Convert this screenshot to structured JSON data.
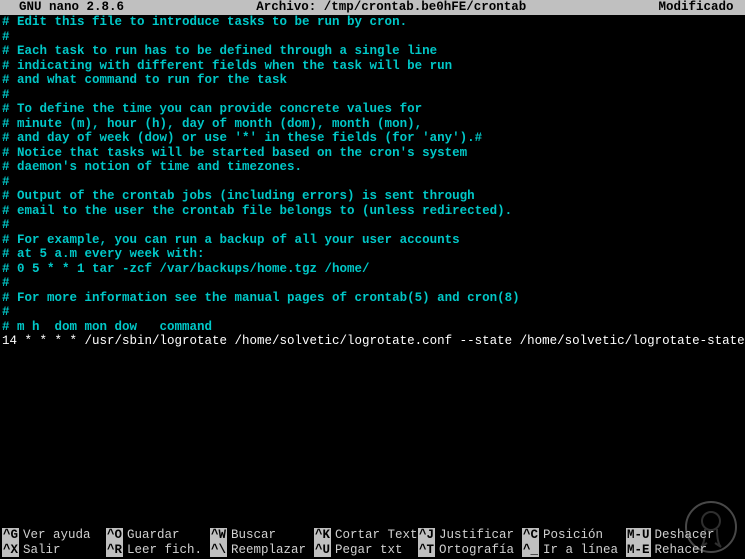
{
  "titlebar": {
    "left": "  GNU nano 2.8.6",
    "center": "Archivo: /tmp/crontab.be0hFE/crontab",
    "right": "Modificado "
  },
  "lines": [
    {
      "cls": "cyan",
      "text": "# Edit this file to introduce tasks to be run by cron."
    },
    {
      "cls": "cyan",
      "text": "#"
    },
    {
      "cls": "cyan",
      "text": "# Each task to run has to be defined through a single line"
    },
    {
      "cls": "cyan",
      "text": "# indicating with different fields when the task will be run"
    },
    {
      "cls": "cyan",
      "text": "# and what command to run for the task"
    },
    {
      "cls": "cyan",
      "text": "#"
    },
    {
      "cls": "cyan",
      "text": "# To define the time you can provide concrete values for"
    },
    {
      "cls": "cyan",
      "text": "# minute (m), hour (h), day of month (dom), month (mon),"
    },
    {
      "cls": "cyan",
      "text": "# and day of week (dow) or use '*' in these fields (for 'any').#"
    },
    {
      "cls": "cyan",
      "text": "# Notice that tasks will be started based on the cron's system"
    },
    {
      "cls": "cyan",
      "text": "# daemon's notion of time and timezones."
    },
    {
      "cls": "cyan",
      "text": "#"
    },
    {
      "cls": "cyan",
      "text": "# Output of the crontab jobs (including errors) is sent through"
    },
    {
      "cls": "cyan",
      "text": "# email to the user the crontab file belongs to (unless redirected)."
    },
    {
      "cls": "cyan",
      "text": "#"
    },
    {
      "cls": "cyan",
      "text": "# For example, you can run a backup of all your user accounts"
    },
    {
      "cls": "cyan",
      "text": "# at 5 a.m every week with:"
    },
    {
      "cls": "cyan",
      "text": "# 0 5 * * 1 tar -zcf /var/backups/home.tgz /home/"
    },
    {
      "cls": "cyan",
      "text": "#"
    },
    {
      "cls": "cyan",
      "text": "# For more information see the manual pages of crontab(5) and cron(8)"
    },
    {
      "cls": "cyan",
      "text": "#"
    },
    {
      "cls": "cyan",
      "text": "# m h  dom mon dow   command"
    },
    {
      "cls": "whitebright",
      "text": "14 * * * * /usr/sbin/logrotate /home/solvetic/logrotate.conf --state /home/solvetic/logrotate-state"
    }
  ],
  "shortcuts": {
    "row1": [
      {
        "key": "^G",
        "desc": "Ver ayuda"
      },
      {
        "key": "^O",
        "desc": "Guardar"
      },
      {
        "key": "^W",
        "desc": "Buscar"
      },
      {
        "key": "^K",
        "desc": "Cortar Text"
      },
      {
        "key": "^J",
        "desc": "Justificar"
      },
      {
        "key": "^C",
        "desc": "Posición"
      },
      {
        "key": "M-U",
        "desc": "Deshacer"
      }
    ],
    "row2": [
      {
        "key": "^X",
        "desc": "Salir"
      },
      {
        "key": "^R",
        "desc": "Leer fich."
      },
      {
        "key": "^\\",
        "desc": "Reemplazar"
      },
      {
        "key": "^U",
        "desc": "Pegar txt"
      },
      {
        "key": "^T",
        "desc": "Ortografía"
      },
      {
        "key": "^_",
        "desc": "Ir a línea"
      },
      {
        "key": "M-E",
        "desc": "Rehacer"
      }
    ]
  }
}
